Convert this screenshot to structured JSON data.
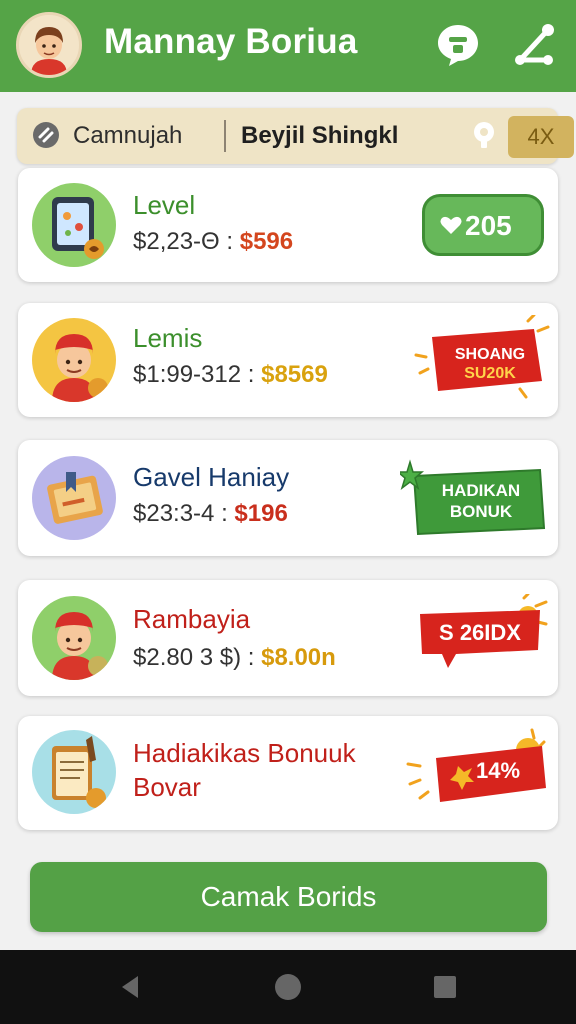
{
  "header": {
    "title": "Mannay Boriua",
    "chat_icon": "chat-bubble-icon",
    "share_icon": "share-icon"
  },
  "filter_bar": {
    "chip1": "Camnujah",
    "chip2": "Beyjil Shingkl",
    "multiplier": "4X"
  },
  "cards": [
    {
      "title": "Level",
      "sub_prefix": "$2,23-Θ :",
      "sub_value": "$596",
      "badge": "205",
      "title_color": "#3c8f2c",
      "value_color": "#d4461e"
    },
    {
      "title": "Lemis",
      "sub_prefix": "$1:99-312 :",
      "sub_value": "$8569",
      "badge_line1": "SHOANG",
      "badge_line2": "SU20K",
      "title_color": "#3c8f2c",
      "value_color": "#d9a20e"
    },
    {
      "title": "Gavel Haniay",
      "sub_prefix": "$23:3-4 :",
      "sub_value": "$196",
      "badge_line1": "HADIKAN",
      "badge_line2": "BONUK",
      "title_color": "#173a6b",
      "value_color": "#c92f1d"
    },
    {
      "title": "Rambayia",
      "sub_prefix": "$2.80 3 $) :",
      "sub_value": "$8.00n",
      "badge": "S 26IDX",
      "title_color": "#c0201a",
      "value_color": "#d79a0c"
    },
    {
      "title": "Hadiakikas Bonuuk",
      "title2": "Bovar",
      "badge": "14%",
      "title_color": "#c0201a"
    }
  ],
  "cta": {
    "label": "Camak Borids"
  },
  "colors": {
    "brand_green": "#55a447",
    "accent_red": "#d7241d",
    "gold": "#d2b35f"
  }
}
